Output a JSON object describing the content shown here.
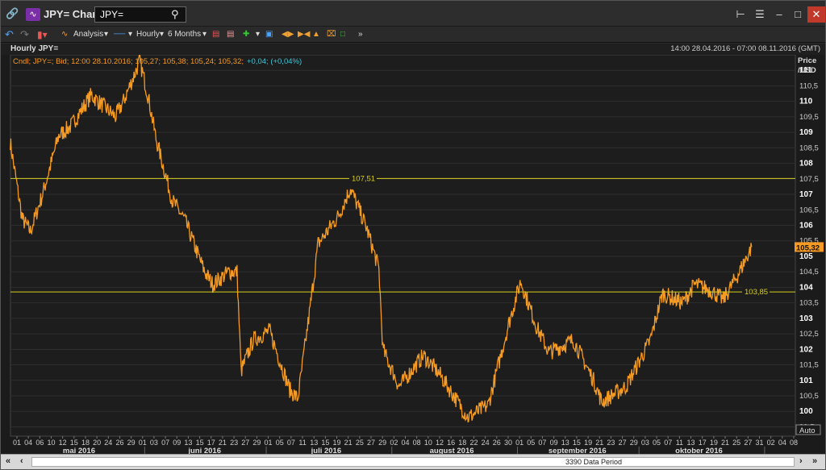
{
  "titlebar": {
    "title": "JPY= Chart",
    "search_value": "JPY="
  },
  "toolbar": {
    "analysis_label": "Analysis",
    "interval_label": "Hourly",
    "range_label": "6 Months"
  },
  "chart_head": {
    "left_title": "Hourly JPY=",
    "right_period": "14:00 28.04.2016 - 07:00 08.11.2016 (GMT)"
  },
  "legend": {
    "text": "Cndl; JPY=; Bid; 12:00 28.10.2016; 105,27; 105,38; 105,24; 105,32;",
    "change": "+0,04; (+0,04%)"
  },
  "axis": {
    "price_label_1": "Price",
    "price_label_2": "/USD",
    "auto_label": "Auto",
    "y_ticks": [
      "111",
      "110,5",
      "110",
      "109,5",
      "109",
      "108,5",
      "108",
      "107,5",
      "107",
      "106,5",
      "106",
      "105,5",
      "105",
      "104,5",
      "104",
      "103,5",
      "103",
      "102,5",
      "102",
      "101,5",
      "101",
      "100,5",
      "100",
      "99,5"
    ],
    "x_ticks": [
      "01",
      "04",
      "06",
      "10",
      "12",
      "15",
      "18",
      "20",
      "24",
      "26",
      "29",
      "01",
      "03",
      "07",
      "09",
      "13",
      "15",
      "17",
      "21",
      "23",
      "27",
      "29",
      "01",
      "05",
      "07",
      "11",
      "13",
      "15",
      "19",
      "21",
      "25",
      "27",
      "29",
      "02",
      "04",
      "08",
      "10",
      "12",
      "16",
      "18",
      "22",
      "24",
      "26",
      "30",
      "01",
      "05",
      "07",
      "09",
      "13",
      "15",
      "19",
      "21",
      "23",
      "27",
      "29",
      "03",
      "05",
      "07",
      "11",
      "13",
      "17",
      "19",
      "21",
      "25",
      "27",
      "31",
      "02",
      "04",
      "08"
    ],
    "months": [
      "mai 2016",
      "juni 2016",
      "juli 2016",
      "august 2016",
      "september 2016",
      "oktober 2016"
    ],
    "current_price": "105,32",
    "hline_high": "107,51",
    "hline_low": "103,85"
  },
  "scrollbar": {
    "label": "3390 Data Period"
  },
  "colors": {
    "series": "#f59a23",
    "hline": "#d8cf20",
    "change": "#3ec6d8"
  },
  "chart_data": {
    "type": "line",
    "title": "Hourly JPY=",
    "ylabel": "Price /USD",
    "ylim": [
      99.2,
      111.5
    ],
    "grid": true,
    "hlines": [
      107.51,
      103.85
    ],
    "x": [
      "2016-04-28",
      "2016-05-01",
      "2016-05-03",
      "2016-05-06",
      "2016-05-10",
      "2016-05-13",
      "2016-05-18",
      "2016-05-24",
      "2016-05-26",
      "2016-05-30",
      "2016-06-01",
      "2016-06-03",
      "2016-06-07",
      "2016-06-10",
      "2016-06-15",
      "2016-06-17",
      "2016-06-21",
      "2016-06-23",
      "2016-06-24",
      "2016-06-27",
      "2016-07-01",
      "2016-07-06",
      "2016-07-08",
      "2016-07-11",
      "2016-07-13",
      "2016-07-18",
      "2016-07-21",
      "2016-07-25",
      "2016-07-28",
      "2016-07-29",
      "2016-08-02",
      "2016-08-08",
      "2016-08-12",
      "2016-08-16",
      "2016-08-19",
      "2016-08-24",
      "2016-08-29",
      "2016-09-01",
      "2016-09-05",
      "2016-09-08",
      "2016-09-14",
      "2016-09-19",
      "2016-09-21",
      "2016-09-27",
      "2016-10-03",
      "2016-10-06",
      "2016-10-11",
      "2016-10-14",
      "2016-10-18",
      "2016-10-21",
      "2016-10-25",
      "2016-10-28"
    ],
    "values": [
      108.7,
      106.2,
      105.8,
      107.0,
      108.9,
      109.2,
      110.2,
      109.5,
      110.0,
      111.3,
      110.2,
      108.8,
      106.8,
      106.2,
      104.5,
      104.1,
      104.5,
      104.5,
      101.3,
      102.3,
      102.6,
      100.7,
      100.4,
      103.3,
      105.4,
      106.3,
      107.2,
      105.9,
      104.6,
      102.0,
      100.8,
      101.8,
      101.2,
      100.4,
      99.8,
      100.2,
      102.8,
      104.2,
      102.7,
      101.9,
      102.3,
      101.0,
      100.3,
      100.8,
      102.3,
      103.8,
      103.5,
      104.1,
      103.9,
      103.6,
      104.5,
      105.3
    ]
  }
}
